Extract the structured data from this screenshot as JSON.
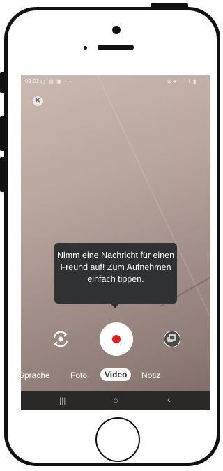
{
  "status_bar": {
    "time": "08:02",
    "left_icons": "◷ ▤ ▣  ···",
    "right_icons": "⊠◂ ⌔.ıl ▮"
  },
  "tooltip": {
    "text": "Nimm eine Nachricht für einen Freund auf! Zum Aufnehmen einfach tippen."
  },
  "modes": [
    "Sprache",
    "Foto",
    "Video",
    "Notiz"
  ],
  "selected_mode": "Video",
  "nav": {
    "recents": "|||",
    "home": "○",
    "back": "‹"
  },
  "colors": {
    "record": "#e3201c",
    "tooltip_bg": "#2f3133"
  },
  "icons": {
    "close": "close-icon",
    "flip_camera": "flip-camera-icon",
    "gallery": "gallery-icon"
  }
}
